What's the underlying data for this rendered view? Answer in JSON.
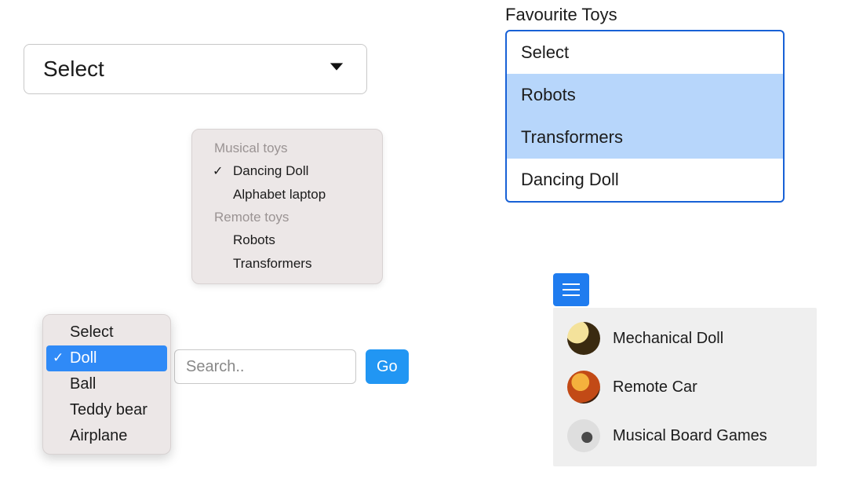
{
  "plain_select": {
    "value": "Select"
  },
  "grouped_popup": {
    "groups": [
      {
        "label": "Musical toys",
        "items": [
          {
            "label": "Dancing Doll",
            "checked": true
          },
          {
            "label": "Alphabet laptop",
            "checked": false
          }
        ]
      },
      {
        "label": "Remote toys",
        "items": [
          {
            "label": "Robots",
            "checked": false
          },
          {
            "label": "Transformers",
            "checked": false
          }
        ]
      }
    ]
  },
  "search": {
    "placeholder": "Search..",
    "value": "",
    "go_label": "Go"
  },
  "simple_popup": {
    "items": [
      {
        "label": "Select",
        "checked": false,
        "selected": false
      },
      {
        "label": "Doll",
        "checked": true,
        "selected": true
      },
      {
        "label": "Ball",
        "checked": false,
        "selected": false
      },
      {
        "label": "Teddy bear",
        "checked": false,
        "selected": false
      },
      {
        "label": "Airplane",
        "checked": false,
        "selected": false
      }
    ]
  },
  "favourite": {
    "title": "Favourite Toys",
    "items": [
      {
        "label": "Select",
        "selected": false
      },
      {
        "label": "Robots",
        "selected": true
      },
      {
        "label": "Transformers",
        "selected": true
      },
      {
        "label": "Dancing Doll",
        "selected": false
      }
    ]
  },
  "icon_list": {
    "items": [
      {
        "label": "Mechanical Doll",
        "thumb": "a"
      },
      {
        "label": "Remote Car",
        "thumb": "b"
      },
      {
        "label": "Musical Board Games",
        "thumb": "c"
      }
    ]
  }
}
